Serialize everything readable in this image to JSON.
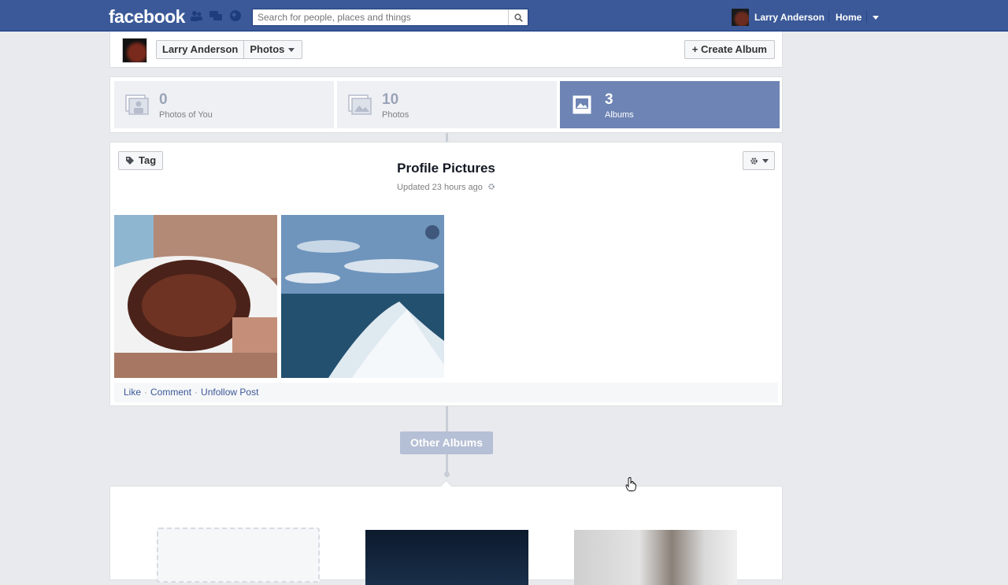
{
  "topbar": {
    "logo": "facebook",
    "search_placeholder": "Search for people, places and things",
    "user_name": "Larry Anderson",
    "home_label": "Home"
  },
  "header": {
    "crumb_name": "Larry Anderson",
    "crumb_section": "Photos",
    "create_album_label": "+ Create Album"
  },
  "tiles": [
    {
      "count": "0",
      "label": "Photos of You",
      "icon": "photos-of-you-icon",
      "active": false
    },
    {
      "count": "10",
      "label": "Photos",
      "icon": "photos-icon",
      "active": false
    },
    {
      "count": "3",
      "label": "Albums",
      "icon": "albums-icon",
      "active": true
    }
  ],
  "album": {
    "tag_label": "Tag",
    "title": "Profile Pictures",
    "updated": "Updated 23 hours ago",
    "actions": {
      "like": "Like",
      "comment": "Comment",
      "unfollow": "Unfollow Post"
    }
  },
  "other_albums_label": "Other Albums",
  "colors": {
    "brand": "#3b5998",
    "active_tile": "#6d84b4",
    "background": "#e9eaed"
  }
}
